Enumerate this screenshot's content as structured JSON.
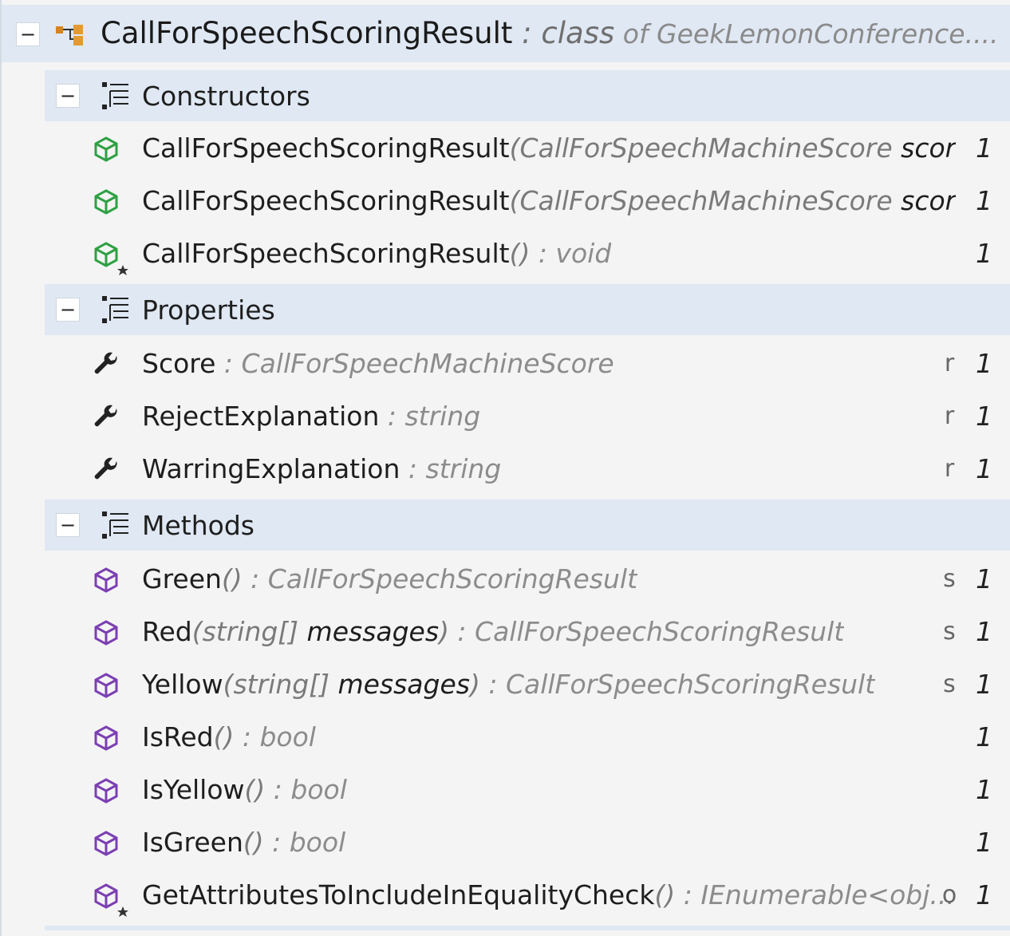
{
  "class": {
    "toggle": "−",
    "name": "CallForSpeechScoringResult",
    "separator": " : ",
    "kind": "class",
    "of_text": " of GeekLemonConference...."
  },
  "groups": [
    {
      "label": "Constructors",
      "toggle": "−",
      "items": [
        {
          "name": "CallForSpeechScoringResult",
          "open": "(",
          "ptype": "CallForSpeechMachineScore",
          "pname": " score,...",
          "close": "",
          "rtype": "",
          "modifier": "",
          "count": "1"
        },
        {
          "name": "CallForSpeechScoringResult",
          "open": "(",
          "ptype": "CallForSpeechMachineScore",
          "pname": " score,...",
          "close": "",
          "rtype": "",
          "modifier": "",
          "count": "1"
        },
        {
          "name": "CallForSpeechScoringResult",
          "open": "()",
          "ptype": "",
          "pname": "",
          "close": "",
          "rtype": " : void",
          "modifier": "",
          "count": "1"
        }
      ]
    },
    {
      "label": "Properties",
      "toggle": "−",
      "items": [
        {
          "name": "Score",
          "rtype": " : CallForSpeechMachineScore",
          "modifier": "r",
          "count": "1"
        },
        {
          "name": "RejectExplanation",
          "rtype": " : string",
          "modifier": "r",
          "count": "1"
        },
        {
          "name": "WarringExplanation",
          "rtype": " : string",
          "modifier": "r",
          "count": "1"
        }
      ]
    },
    {
      "label": "Methods",
      "toggle": "−",
      "items": [
        {
          "name": "Green",
          "open": "()",
          "ptype": "",
          "pname": "",
          "close": "",
          "rtype": " : CallForSpeechScoringResult",
          "modifier": "s",
          "count": "1"
        },
        {
          "name": "Red",
          "open": "(",
          "ptype": "string[]",
          "pname": " messages",
          "close": ")",
          "rtype": " : CallForSpeechScoringResult",
          "modifier": "s",
          "count": "1"
        },
        {
          "name": "Yellow",
          "open": "(",
          "ptype": "string[]",
          "pname": " messages",
          "close": ")",
          "rtype": " : CallForSpeechScoringResult",
          "modifier": "s",
          "count": "1"
        },
        {
          "name": "IsRed",
          "open": "()",
          "ptype": "",
          "pname": "",
          "close": "",
          "rtype": " : bool",
          "modifier": "",
          "count": "1"
        },
        {
          "name": "IsYellow",
          "open": "()",
          "ptype": "",
          "pname": "",
          "close": "",
          "rtype": " : bool",
          "modifier": "",
          "count": "1"
        },
        {
          "name": "IsGreen",
          "open": "()",
          "ptype": "",
          "pname": "",
          "close": "",
          "rtype": " : bool",
          "modifier": "",
          "count": "1"
        },
        {
          "name": "GetAttributesToIncludeInEqualityCheck",
          "open": "()",
          "ptype": "",
          "pname": "",
          "close": "",
          "rtype": " : IEnumerable<obj...",
          "modifier": "o",
          "count": "1"
        }
      ]
    }
  ],
  "icons": {
    "class": "class-icon",
    "group": "member-group-icon",
    "constructor": "constructor-cube-icon",
    "property": "wrench-icon",
    "method": "method-cube-icon",
    "override_marker": "star-icon"
  },
  "colors": {
    "header_bg": "#dfe8f3",
    "constructor_green": "#2ea043",
    "method_purple": "#7b3fb2",
    "class_orange": "#d5841f"
  }
}
